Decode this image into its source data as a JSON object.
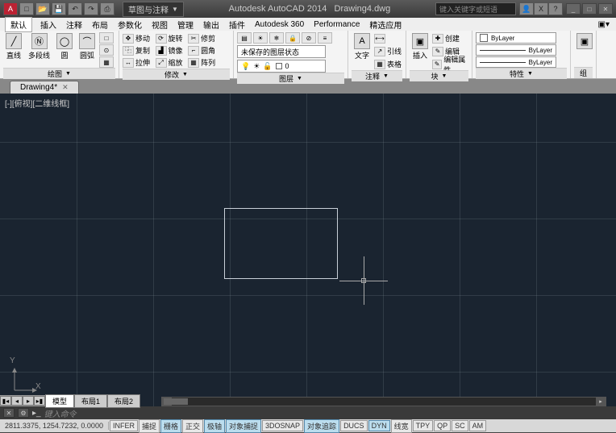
{
  "titlebar": {
    "workspace": "草图与注释",
    "app": "Autodesk AutoCAD 2014",
    "file": "Drawing4.dwg",
    "search_placeholder": "键入关键字或短语"
  },
  "menu": {
    "items": [
      "默认",
      "插入",
      "注释",
      "布局",
      "参数化",
      "视图",
      "管理",
      "输出",
      "插件",
      "Autodesk 360",
      "Performance",
      "精选应用"
    ]
  },
  "ribbon": {
    "draw": {
      "title": "绘图",
      "line": "直线",
      "polyline": "多段线",
      "circle": "圆",
      "arc": "圆弧"
    },
    "modify": {
      "title": "修改",
      "move": "移动",
      "rotate": "旋转",
      "trim": "修剪",
      "copy": "复制",
      "mirror": "镜像",
      "fillet": "圆角",
      "stretch": "拉伸",
      "scale": "缩放",
      "array": "阵列"
    },
    "layers": {
      "title": "图层",
      "state": "未保存的图层状态",
      "current": "0"
    },
    "annotation": {
      "title": "注释",
      "text": "文字",
      "leader": "引线",
      "table": "表格"
    },
    "block": {
      "title": "块",
      "insert": "插入",
      "create": "创建",
      "edit": "编辑",
      "editattr": "编辑属性"
    },
    "properties": {
      "title": "特性",
      "color": "ByLayer",
      "lw": "ByLayer",
      "lt": "ByLayer"
    },
    "groups": {
      "title": "组"
    }
  },
  "filetab": {
    "name": "Drawing4*"
  },
  "viewport": {
    "label": "[-][俯视][二维线框]"
  },
  "ucs": {
    "x": "X",
    "y": "Y"
  },
  "modeltabs": {
    "model": "模型",
    "layout1": "布局1",
    "layout2": "布局2"
  },
  "cmdline": {
    "prompt": "键入命令"
  },
  "status": {
    "coords": "2811.3375, 1254.7232, 0.0000",
    "buttons": [
      "INFER",
      "捕捉",
      "栅格",
      "正交",
      "极轴",
      "对象捕捉",
      "3DOSNAP",
      "对象追踪",
      "DUCS",
      "DYN",
      "线宽",
      "TPY",
      "QP",
      "SC",
      "AM"
    ]
  }
}
